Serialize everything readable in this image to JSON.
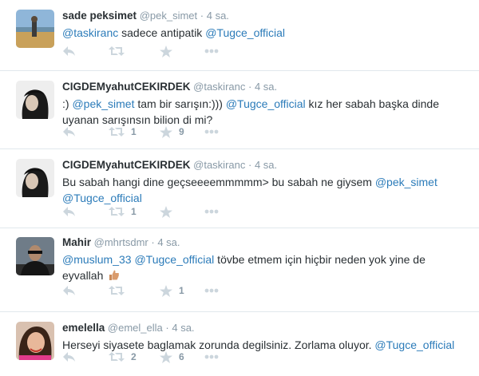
{
  "tweets": [
    {
      "fullname": "sade peksimet",
      "username": "@pek_simet",
      "separator": "·",
      "time": "4 sa.",
      "segments": [
        {
          "t": "@taskiranc",
          "m": true
        },
        {
          "t": " sadece antipatik ",
          "m": false
        },
        {
          "t": "@Tugce_official",
          "m": true
        }
      ],
      "retweets": "",
      "favorites": ""
    },
    {
      "fullname": "CIGDEMyahutCEKIRDEK",
      "username": "@taskiranc",
      "separator": "·",
      "time": "4 sa.",
      "segments": [
        {
          "t": ":) ",
          "m": false
        },
        {
          "t": "@pek_simet",
          "m": true
        },
        {
          "t": " tam bir sarışın:))) ",
          "m": false
        },
        {
          "t": "@Tugce_official",
          "m": true
        },
        {
          "t": " kız her sabah başka dinde uyanan sarışınsın bilion di mi?",
          "m": false
        }
      ],
      "retweets": "1",
      "favorites": "9"
    },
    {
      "fullname": "CIGDEMyahutCEKIRDEK",
      "username": "@taskiranc",
      "separator": "·",
      "time": "4 sa.",
      "segments": [
        {
          "t": "Bu sabah hangi dine geçseeeemmmmm> bu sabah ne giysem ",
          "m": false
        },
        {
          "t": "@pek_simet",
          "m": true
        },
        {
          "t": " ",
          "m": false
        },
        {
          "t": "@Tugce_official",
          "m": true
        }
      ],
      "retweets": "1",
      "favorites": ""
    },
    {
      "fullname": "Mahir",
      "username": "@mhrtsdmr",
      "separator": "·",
      "time": "4 sa.",
      "segments": [
        {
          "t": "@muslum_33",
          "m": true
        },
        {
          "t": " ",
          "m": false
        },
        {
          "t": "@Tugce_official",
          "m": true
        },
        {
          "t": " tövbe etmem için hiçbir neden yok yine de eyvallah ",
          "m": false
        }
      ],
      "emoji": "thumbs-up-icon",
      "retweets": "",
      "favorites": "1"
    },
    {
      "fullname": "emelella",
      "username": "@emel_ella",
      "separator": "·",
      "time": "4 sa.",
      "segments": [
        {
          "t": "Herseyi siyasete baglamak zorunda degilsiniz. Zorlama oluyor.  ",
          "m": false
        },
        {
          "t": "@Tugce_official",
          "m": true
        }
      ],
      "retweets": "2",
      "favorites": "6"
    }
  ],
  "colors": {
    "mention": "#2b7bb9",
    "meta": "#8899a6",
    "icon": "#ccd6dd",
    "divider": "#e1e8ed"
  }
}
